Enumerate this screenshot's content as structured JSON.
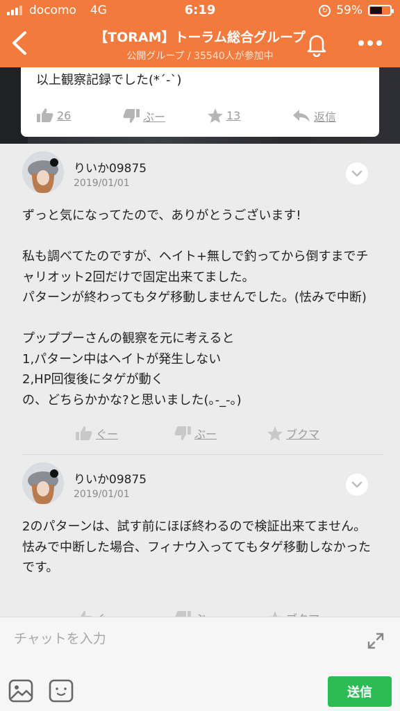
{
  "status_bar": {
    "carrier": "docomo",
    "network": "4G",
    "time": "6:19",
    "battery_percent": "59%",
    "battery_level": 0.59
  },
  "header": {
    "title": "【TORAM】トーラム総合グループ",
    "subtitle": "公開グループ / 35540人が参加中",
    "icons": [
      "back-icon",
      "bell-icon",
      "more-icon"
    ]
  },
  "first_card": {
    "text": "以上観察記録でした(*´-`)",
    "like_count": "26",
    "boo_label": "ぶー",
    "star_count": "13",
    "reply_label": "返信"
  },
  "posts": [
    {
      "author": "りいか09875",
      "date": "2019/01/01",
      "body": "ずっと気になってたので、ありがとうございます!\n\n私も調べてたのですが、ヘイト+無しで釣ってから倒すまでチャリオット2回だけで固定出来てました。\nパターンが終わってもタゲ移動しませんでした。(怯みで中断)\n\nプッププーさんの観察を元に考えると\n1,パターン中はヘイトが発生しない\n2,HP回復後にタゲが動く\nの、どちらかかな?と思いました(｡-_-｡)",
      "actions": {
        "good": "ぐー",
        "boo": "ぶー",
        "bookmark": "ブクマ"
      }
    },
    {
      "author": "りいか09875",
      "date": "2019/01/01",
      "body": "2のパターンは、試す前にほぼ終わるので検証出来てません。\n怯みで中断した場合、フィナウ入っててもタゲ移動しなかったです。",
      "actions": {
        "good": "ぐー",
        "boo": "ぶー",
        "bookmark": "ブクマ"
      }
    }
  ],
  "composer": {
    "placeholder": "チャットを入力",
    "send_label": "送信",
    "icons": [
      "image-icon",
      "emoji-icon",
      "expand-icon"
    ]
  },
  "colors": {
    "header_bg": "#f27a3d",
    "send_bg": "#2dbb55"
  }
}
